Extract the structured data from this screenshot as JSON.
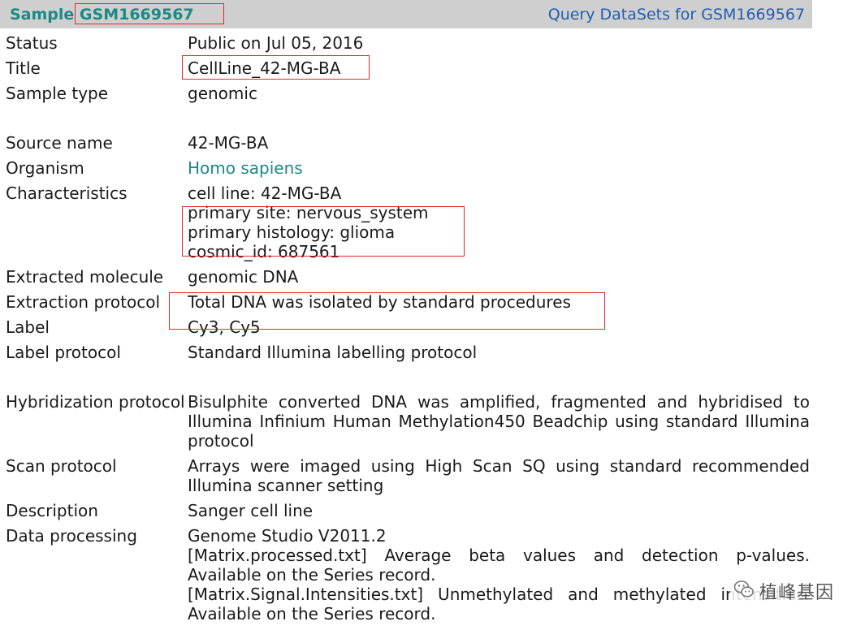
{
  "header": {
    "sample_title": "Sample GSM1669567",
    "query_link": "Query DataSets for GSM1669567"
  },
  "fields": {
    "status": {
      "label": "Status",
      "value": "Public on Jul 05, 2016"
    },
    "title": {
      "label": "Title",
      "value": "CellLine_42-MG-BA"
    },
    "sample_type": {
      "label": "Sample type",
      "value": "genomic"
    },
    "source_name": {
      "label": "Source name",
      "value": "42-MG-BA"
    },
    "organism": {
      "label": "Organism",
      "value": "Homo sapiens"
    },
    "characteristics": {
      "label": "Characteristics",
      "lines": [
        "cell line: 42-MG-BA",
        "primary site: nervous_system",
        "primary histology: glioma",
        "cosmic_id: 687561"
      ]
    },
    "extracted_molecule": {
      "label": "Extracted molecule",
      "value": "genomic DNA"
    },
    "extraction_protocol": {
      "label": "Extraction protocol",
      "value": "Total DNA was isolated by standard procedures"
    },
    "label": {
      "label": "Label",
      "value": "Cy3, Cy5"
    },
    "label_protocol": {
      "label": "Label protocol",
      "value": "Standard Illumina labelling protocol"
    },
    "hybridization_protocol": {
      "label": "Hybridization protocol",
      "value": "Bisulphite converted DNA was amplified, fragmented and hybridised to Illumina Infinium Human Methylation450 Beadchip using standard Illumina protocol"
    },
    "scan_protocol": {
      "label": "Scan protocol",
      "value": "Arrays were imaged using High Scan SQ using standard recommended Illumina scanner setting"
    },
    "description": {
      "label": "Description",
      "value": "Sanger cell line"
    },
    "data_processing": {
      "label": "Data processing",
      "lines": [
        "Genome Studio V2011.2",
        "[Matrix.processed.txt] Average beta values and detection p-values. Available on the Series record.",
        "[Matrix.Signal.Intensities.txt] Unmethylated and methylated intensities. Available on the Series record."
      ]
    }
  },
  "watermark": {
    "text": "植峰基因",
    "icon": "wechat-icon"
  },
  "colors": {
    "header_bg": "#cfcfcf",
    "teal": "#1b8a86",
    "link_blue": "#1f5fb4",
    "annotation_red": "#e02a2a"
  }
}
